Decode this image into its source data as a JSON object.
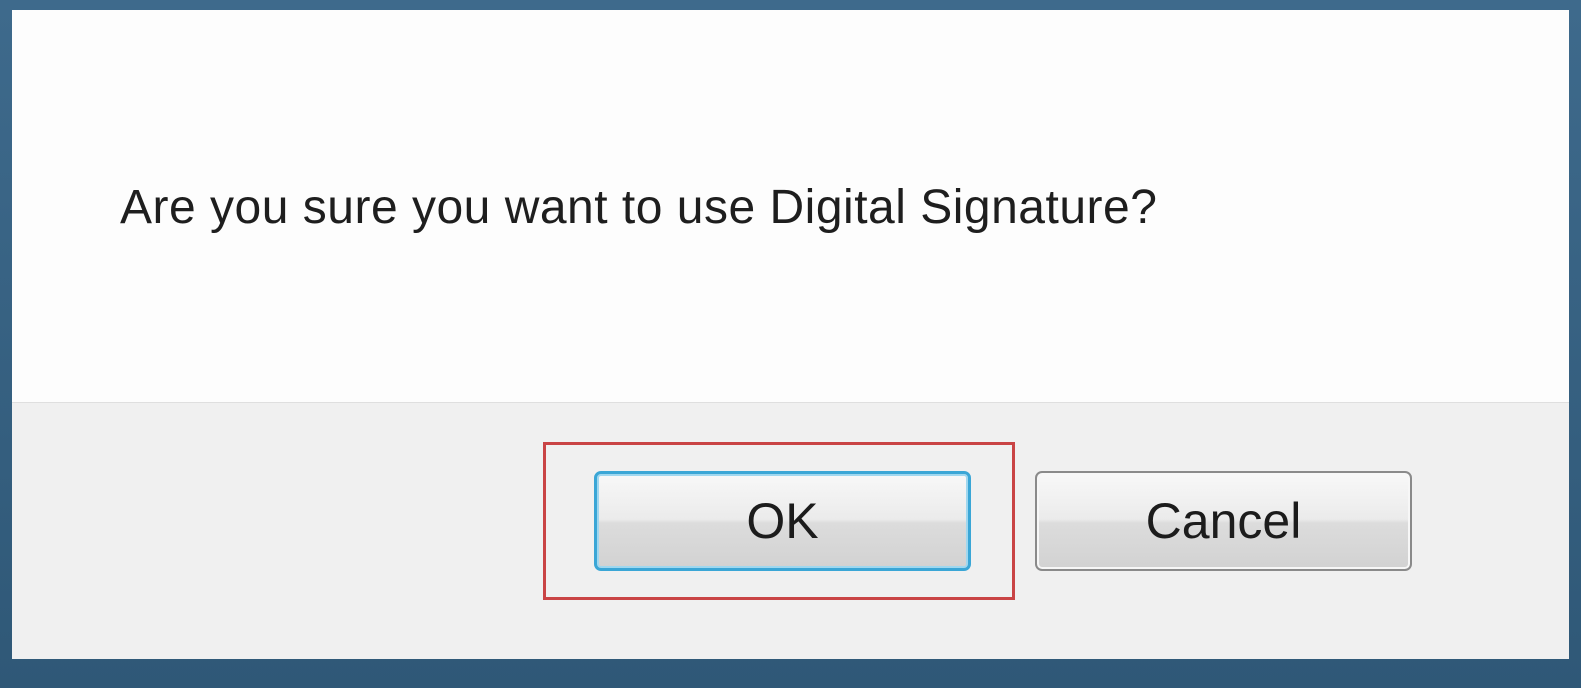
{
  "dialog": {
    "message": "Are you sure you want to use Digital Signature?"
  },
  "buttons": {
    "ok_label": "OK",
    "cancel_label": "Cancel"
  },
  "colors": {
    "window_frame": "#3b6688",
    "dialog_background": "#fcfcfc",
    "button_bar_background": "#f0f0f0",
    "ok_focus_border": "#3aa6d6",
    "highlight_annotation": "#c94445"
  }
}
